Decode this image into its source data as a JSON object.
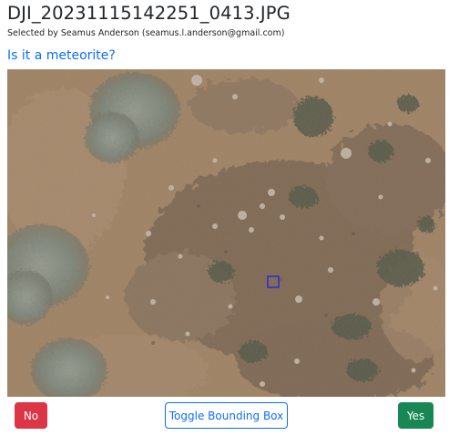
{
  "header": {
    "filename": "DJI_20231115142251_0413.JPG",
    "selected_by": "Selected by Seamus Anderson (seamus.l.anderson@gmail.com)",
    "question": "Is it a meteorite?"
  },
  "photo": {
    "description_icon": "aerial-ground-photo",
    "bounding_box_color": "#2b2bd8"
  },
  "actions": {
    "no_label": "No",
    "toggle_label": "Toggle Bounding Box",
    "yes_label": "Yes"
  },
  "colors": {
    "accent": "#0d6efd",
    "danger": "#dc3545",
    "success": "#198754"
  }
}
